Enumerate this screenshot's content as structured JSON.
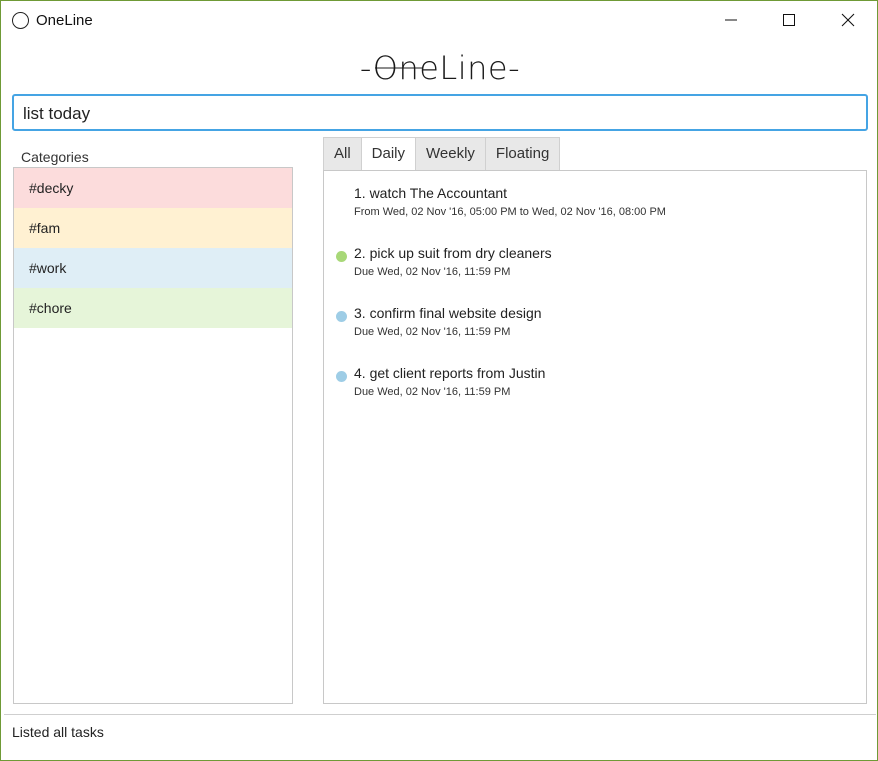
{
  "window": {
    "title": "OneLine",
    "border_color": "#6f9a36"
  },
  "logo": {
    "text": "-OneLine-"
  },
  "command": {
    "value": "list today",
    "focus_color": "#45a4e4"
  },
  "categories": {
    "label": "Categories",
    "items": [
      {
        "label": "#decky",
        "color": "#fcdcdc"
      },
      {
        "label": "#fam",
        "color": "#fff1d2"
      },
      {
        "label": "#work",
        "color": "#dfeef6"
      },
      {
        "label": "#chore",
        "color": "#e6f5d9"
      }
    ]
  },
  "tabs": [
    {
      "label": "All",
      "active": false
    },
    {
      "label": "Daily",
      "active": true
    },
    {
      "label": "Weekly",
      "active": false
    },
    {
      "label": "Floating",
      "active": false
    }
  ],
  "tasks": [
    {
      "title": "1. watch The Accountant",
      "detail": "From Wed, 02 Nov '16, 05:00 PM to Wed, 02 Nov '16, 08:00 PM",
      "dot_color": null
    },
    {
      "title": "2. pick up suit from dry cleaners",
      "detail": "Due Wed, 02 Nov '16, 11:59 PM",
      "dot_color": "#a8d878"
    },
    {
      "title": "3. confirm final website design",
      "detail": "Due Wed, 02 Nov '16, 11:59 PM",
      "dot_color": "#9ecde6"
    },
    {
      "title": "4. get client reports from Justin",
      "detail": "Due Wed, 02 Nov '16, 11:59 PM",
      "dot_color": "#9ecde6"
    }
  ],
  "status": {
    "text": "Listed all tasks"
  }
}
